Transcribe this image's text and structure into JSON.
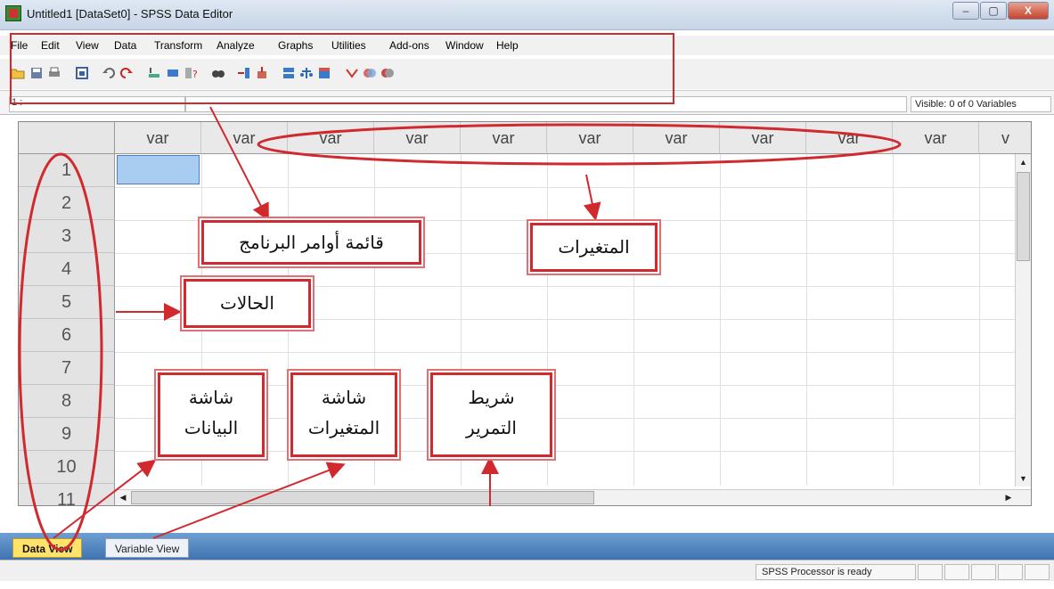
{
  "window": {
    "title": "Untitled1 [DataSet0] - SPSS Data Editor",
    "controls": [
      "–",
      "▢",
      "X"
    ]
  },
  "menu": [
    "File",
    "Edit",
    "View",
    "Data",
    "Transform",
    "Analyze",
    "Graphs",
    "Utilities",
    "Add-ons",
    "Window",
    "Help"
  ],
  "toolbar_icons": [
    "open-icon",
    "save-icon",
    "print-icon",
    "dialog-recall-icon",
    "undo-icon",
    "redo-icon",
    "goto-case-icon",
    "goto-variable-icon",
    "variables-icon",
    "find-icon",
    "insert-cases-icon",
    "insert-variable-icon",
    "split-file-icon",
    "weight-cases-icon",
    "select-cases-icon",
    "value-labels-icon",
    "use-sets-icon",
    "show-all-icon"
  ],
  "cell_editor": {
    "reference": "1 :",
    "visible": "Visible: 0 of 0 Variables"
  },
  "grid": {
    "columns": [
      "var",
      "var",
      "var",
      "var",
      "var",
      "var",
      "var",
      "var",
      "var",
      "var",
      "v"
    ],
    "rows": [
      "1",
      "2",
      "3",
      "4",
      "5",
      "6",
      "7",
      "8",
      "9",
      "10",
      "11"
    ]
  },
  "tabs": {
    "data_view": "Data View",
    "variable_view": "Variable View"
  },
  "status": "SPSS  Processor is ready",
  "annotations": {
    "menu_commands": "قائمة أوامر البرنامج",
    "variables": "المتغيرات",
    "cases": "الحالات",
    "data_screen_line1": "شاشة",
    "data_screen_line2": "البيانات",
    "variables_screen_line1": "شاشة",
    "variables_screen_line2": "المتغيرات",
    "scrollbar_line1": "شريط",
    "scrollbar_line2": "التمرير"
  },
  "colors": {
    "annotation": "#d02a2f",
    "active_tab": "#ffe36b",
    "tab_strip": "#4a7fbd",
    "selected_cell": "#a9cdf0"
  }
}
